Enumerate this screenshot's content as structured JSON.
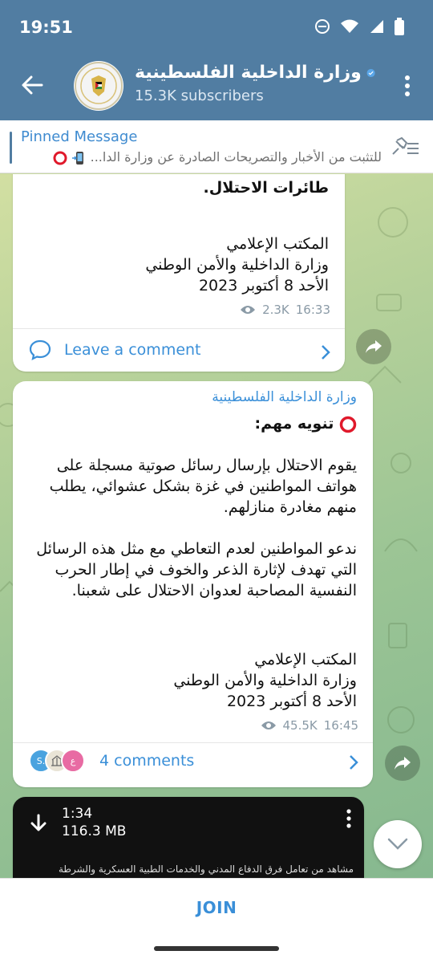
{
  "status_bar": {
    "time": "19:51"
  },
  "header": {
    "title": "وزارة الداخلية الفلسطينية",
    "subscribers": "15.3K subscribers"
  },
  "pinned": {
    "label": "Pinned Message",
    "preview": "للتثبت من الأخبار والتصريحات الصادرة عن وزارة الدا..."
  },
  "messages": [
    {
      "text_top": "طائرات الاحتلال.",
      "signature_1": "المكتب الإعلامي",
      "signature_2": "وزارة الداخلية والأمن الوطني",
      "date": "الأحد 8 أكتوبر 2023",
      "views": "2.3K",
      "time": "16:33",
      "comment_label": "Leave a comment"
    },
    {
      "author": "وزارة الداخلية الفلسطينية",
      "heading": "تنويه مهم:",
      "para1": "يقوم الاحتلال بإرسال رسائل صوتية مسجلة على هواتف المواطنين في غزة بشكل عشوائي، يطلب منهم مغادرة منازلهم.",
      "para2": "ندعو المواطنين لعدم التعاطي مع مثل هذه الرسائل التي تهدف لإثارة الذعر والخوف في إطار الحرب النفسية المصاحبة لعدوان الاحتلال على شعبنا.",
      "signature_1": "المكتب الإعلامي",
      "signature_2": "وزارة الداخلية والأمن الوطني",
      "date": "الأحد 8 أكتوبر 2023",
      "views": "45.5K",
      "time": "16:45",
      "comment_label": "4 comments",
      "commenter_initials": [
        "S.",
        "",
        "ع"
      ]
    },
    {
      "duration": "1:34",
      "size": "116.3 MB",
      "caption": "مشاهد من تعامل فرق الدفاع المدني والخدمات الطبية العسكرية والشرطة"
    }
  ],
  "join_label": "JOIN",
  "colors": {
    "header": "#517da2",
    "accent": "#3a8fd8",
    "verified": "#5aa6e8",
    "red_circle": "#e0192b"
  }
}
